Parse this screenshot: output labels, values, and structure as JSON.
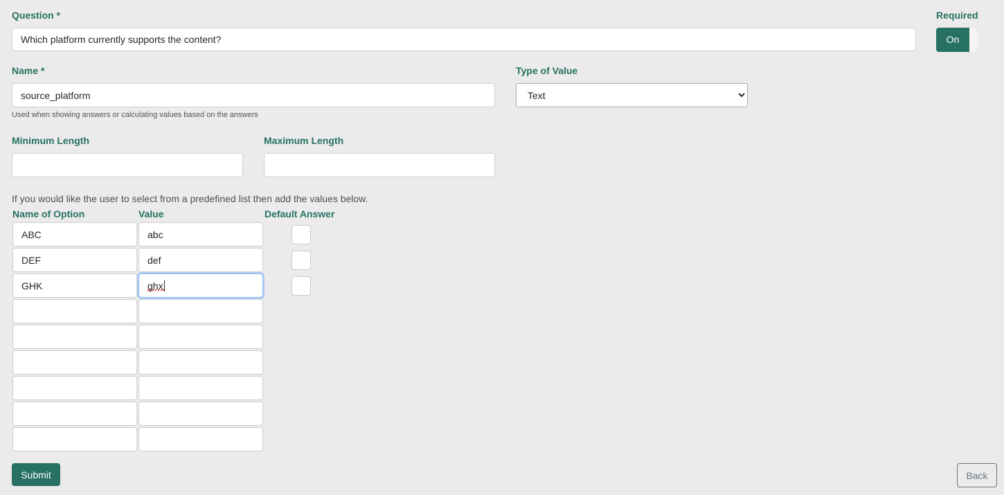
{
  "question": {
    "label": "Question *",
    "value": "Which platform currently supports the content?"
  },
  "required": {
    "label": "Required",
    "toggle_text": "On",
    "state": "on"
  },
  "name": {
    "label": "Name *",
    "value": "source_platform",
    "help": "Used when showing answers or calculating values based on the answers"
  },
  "type_of_value": {
    "label": "Type of Value",
    "selected": "Text"
  },
  "min_length": {
    "label": "Minimum Length",
    "value": ""
  },
  "max_length": {
    "label": "Maximum Length",
    "value": ""
  },
  "options": {
    "intro": "If you would like the user to select from a predefined list then add the values below.",
    "headers": {
      "name": "Name of Option",
      "value": "Value",
      "default": "Default Answer"
    },
    "rows": [
      {
        "name": "ABC",
        "value": "abc",
        "default": false
      },
      {
        "name": "DEF",
        "value": "def",
        "default": false
      },
      {
        "name": "GHK",
        "value": "ghx",
        "default": false,
        "focused": true
      },
      {
        "name": "",
        "value": ""
      },
      {
        "name": "",
        "value": ""
      },
      {
        "name": "",
        "value": ""
      },
      {
        "name": "",
        "value": ""
      },
      {
        "name": "",
        "value": ""
      },
      {
        "name": "",
        "value": ""
      }
    ]
  },
  "buttons": {
    "submit": "Submit",
    "back": "Back"
  },
  "colors": {
    "accent": "#267163",
    "background": "#ebebeb",
    "focus_ring": "#86b7fe"
  }
}
